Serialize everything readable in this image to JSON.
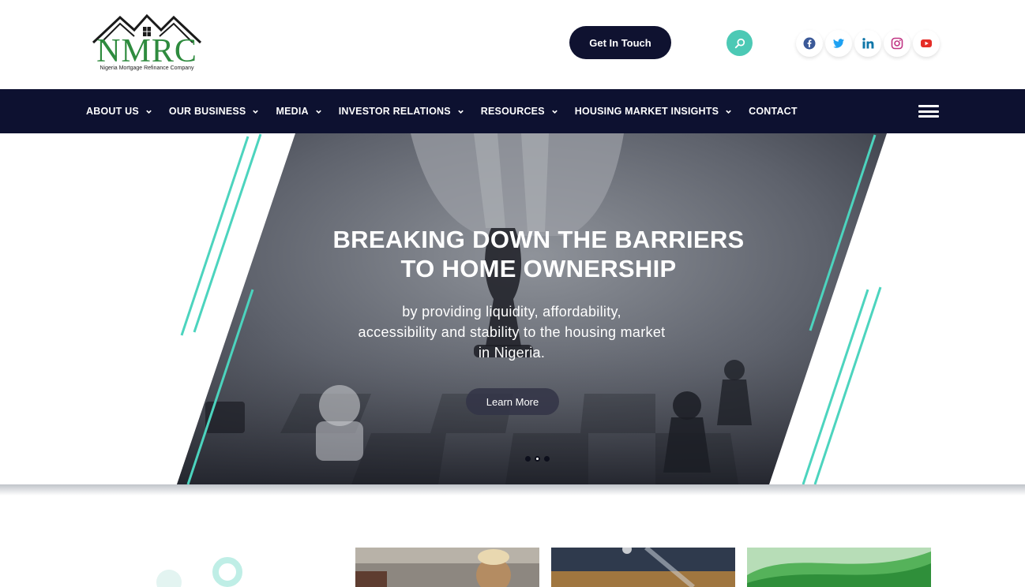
{
  "header": {
    "logo": {
      "text": "NMRC",
      "subtitle": "Nigeria Mortgage Refinance Company"
    },
    "get_in_touch_label": "Get In Touch",
    "socials": [
      "facebook-icon",
      "twitter-icon",
      "linkedin-icon",
      "instagram-icon",
      "youtube-icon"
    ]
  },
  "nav": {
    "items": [
      {
        "label": "ABOUT US",
        "dropdown": true
      },
      {
        "label": "OUR BUSINESS",
        "dropdown": true
      },
      {
        "label": "MEDIA",
        "dropdown": true
      },
      {
        "label": "INVESTOR RELATIONS",
        "dropdown": true
      },
      {
        "label": "RESOURCES",
        "dropdown": true
      },
      {
        "label": "HOUSING MARKET INSIGHTS",
        "dropdown": true
      },
      {
        "label": "CONTACT",
        "dropdown": false
      }
    ]
  },
  "hero": {
    "title_line1": "BREAKING DOWN THE BARRIERS",
    "title_line2": "TO HOME OWNERSHIP",
    "subtitle_line1": "by providing liquidity, affordability,",
    "subtitle_line2": "accessibility and stability to the housing market",
    "subtitle_line3": "in Nigeria.",
    "cta_label": "Learn More",
    "slides_total": 3,
    "active_slide": 2
  },
  "colors": {
    "navy": "#0d1130",
    "teal": "#4cc9b5",
    "logo_green": "#2e8b3e",
    "facebook": "#3b5998",
    "twitter": "#1da1f2",
    "linkedin": "#0e76a8",
    "instagram": "#c13584",
    "youtube": "#e52d27"
  }
}
